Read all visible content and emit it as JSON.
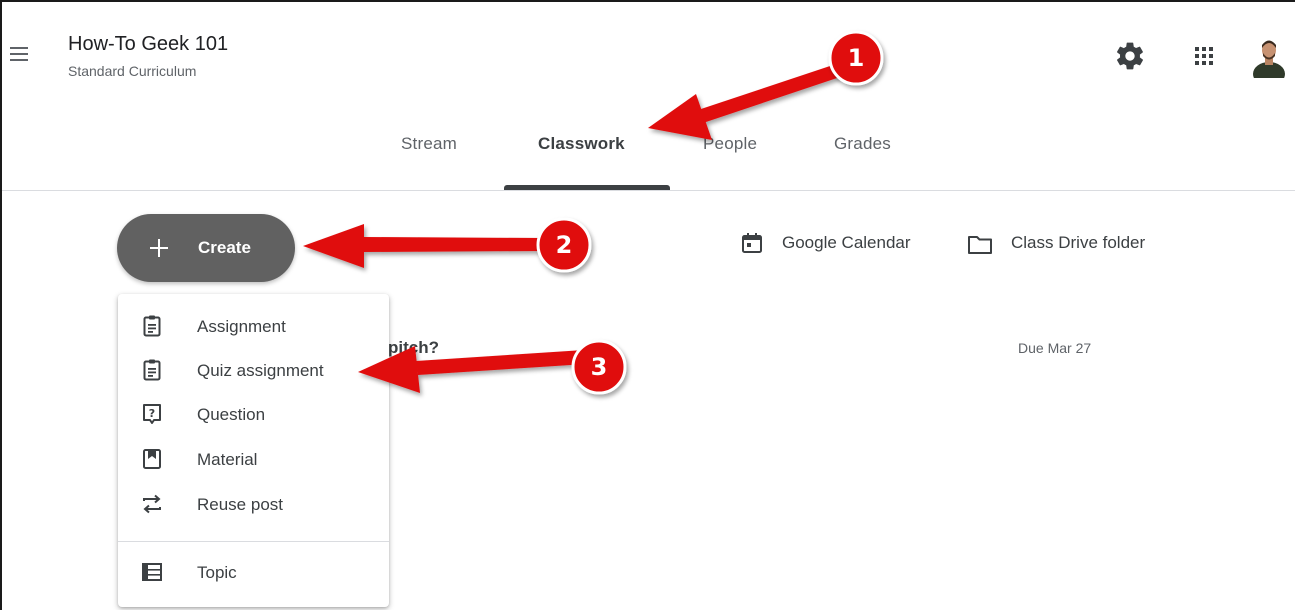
{
  "header": {
    "title": "How-To Geek 101",
    "subtitle": "Standard Curriculum",
    "menu_icon": "hamburger-icon",
    "settings_icon": "gear-icon",
    "apps_icon": "apps-grid-icon",
    "avatar": "user-avatar"
  },
  "tabs": [
    {
      "label": "Stream",
      "active": false
    },
    {
      "label": "Classwork",
      "active": true
    },
    {
      "label": "People",
      "active": false
    },
    {
      "label": "Grades",
      "active": false
    }
  ],
  "create_button": {
    "label": "Create",
    "icon": "plus-icon"
  },
  "links": {
    "calendar": {
      "label": "Google Calendar",
      "icon": "calendar-icon"
    },
    "drive": {
      "label": "Class Drive folder",
      "icon": "folder-icon"
    }
  },
  "background": {
    "partial_title": "pitch?",
    "due": "Due Mar 27"
  },
  "create_menu": {
    "items": [
      {
        "label": "Assignment",
        "icon": "assignment-icon"
      },
      {
        "label": "Quiz assignment",
        "icon": "quiz-assignment-icon"
      },
      {
        "label": "Question",
        "icon": "question-icon"
      },
      {
        "label": "Material",
        "icon": "material-icon"
      },
      {
        "label": "Reuse post",
        "icon": "reuse-post-icon"
      },
      {
        "label": "Topic",
        "icon": "topic-icon"
      }
    ]
  },
  "annotations": [
    {
      "number": "1"
    },
    {
      "number": "2"
    },
    {
      "number": "3"
    }
  ],
  "colors": {
    "annotation_red": "#ee1111",
    "create_button": "#616161",
    "text": "#3c4043"
  }
}
